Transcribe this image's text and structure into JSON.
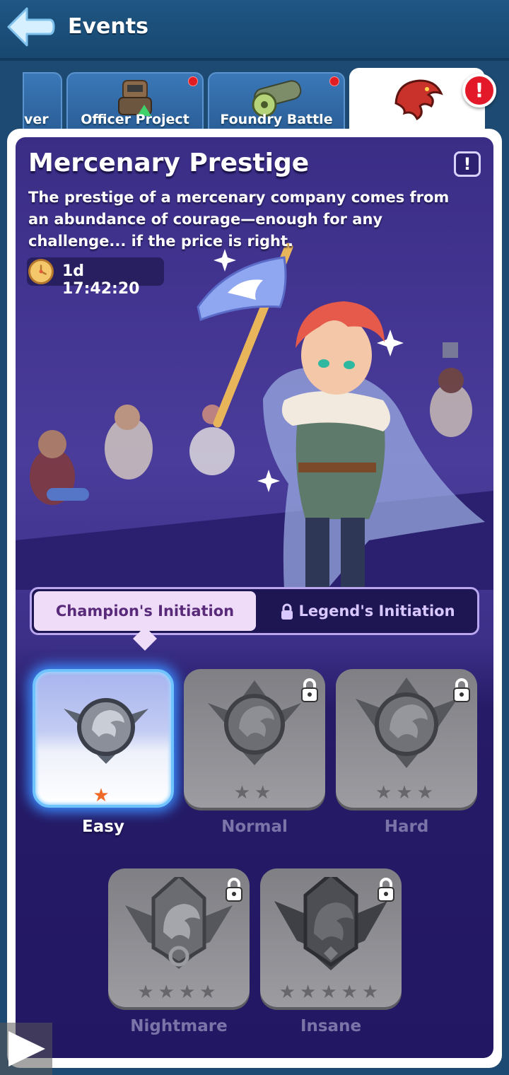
{
  "header": {
    "title": "Events"
  },
  "tabs": [
    {
      "label": "ver",
      "notification": false
    },
    {
      "label": "Officer Project",
      "notification": true
    },
    {
      "label": "Foundry Battle",
      "notification": true
    },
    {
      "label": "",
      "active": true,
      "icon": "red-eagle-emblem-icon"
    }
  ],
  "alert_badge": "!",
  "event": {
    "title": "Mercenary Prestige",
    "description": "The prestige of a mercenary company comes from an abundance of courage—enough for any challenge... if the price is right.",
    "info_label": "!",
    "timer": "1d 17:42:20"
  },
  "mode_toggle": {
    "left": "Champion's Initiation",
    "right": "Legend's Initiation",
    "selected": "left",
    "right_locked": true
  },
  "levels": [
    {
      "label": "Easy",
      "stars": "★",
      "locked": false,
      "active": true
    },
    {
      "label": "Normal",
      "stars": "★★",
      "locked": true,
      "active": false
    },
    {
      "label": "Hard",
      "stars": "★★★",
      "locked": true,
      "active": false
    },
    {
      "label": "Nightmare",
      "stars": "★★★★",
      "locked": true,
      "active": false
    },
    {
      "label": "Insane",
      "stars": "★★★★★",
      "locked": true,
      "active": false
    }
  ],
  "colors": {
    "header_bg": "#1f5683",
    "panel_bg": "#3a2d86",
    "accent_star": "#ef6a28",
    "alert_red": "#e3192a",
    "active_glow": "#3b8dff"
  }
}
